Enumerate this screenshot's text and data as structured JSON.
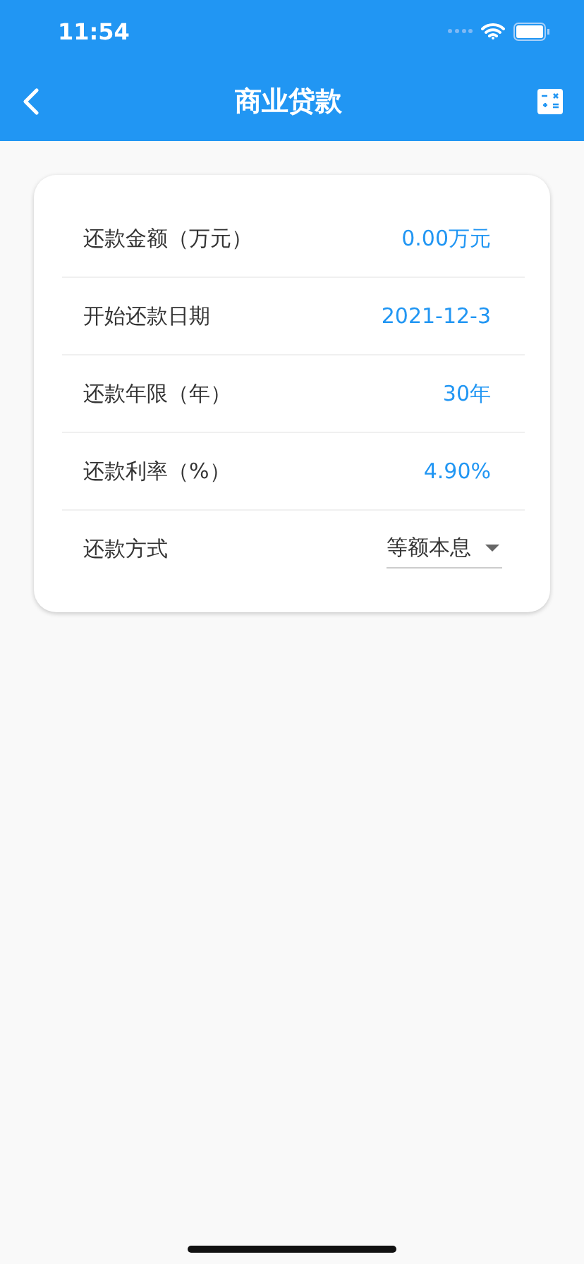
{
  "status_bar": {
    "time": "11:54"
  },
  "nav": {
    "title": "商业贷款"
  },
  "rows": [
    {
      "kind": "value",
      "label": "还款金额（万元）",
      "value": "0.00万元"
    },
    {
      "kind": "value",
      "label": "开始还款日期",
      "value": "2021-12-3"
    },
    {
      "kind": "value",
      "label": "还款年限（年）",
      "value": "30年"
    },
    {
      "kind": "value",
      "label": "还款利率（%）",
      "value": "4.90%"
    },
    {
      "kind": "dropdown",
      "label": "还款方式",
      "value": "等额本息"
    }
  ]
}
